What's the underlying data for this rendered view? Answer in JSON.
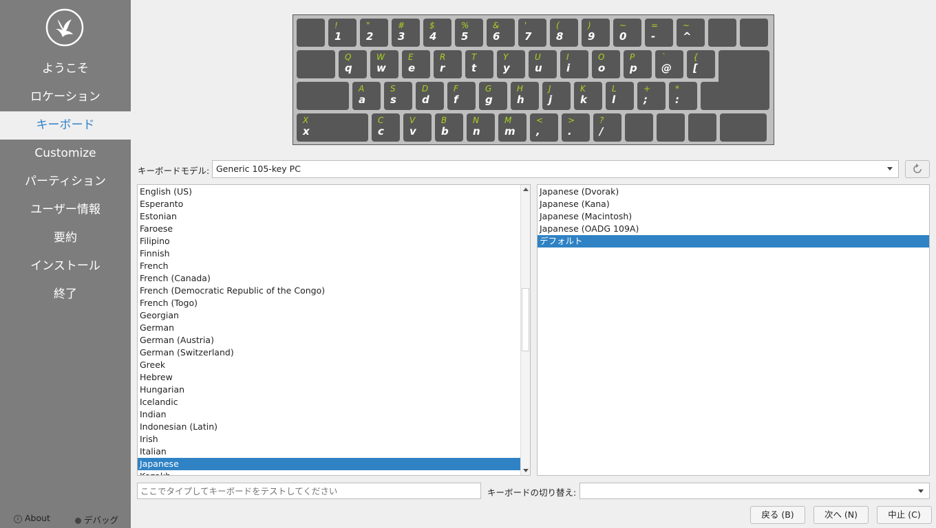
{
  "sidebar": {
    "items": [
      {
        "label": "ようこそ"
      },
      {
        "label": "ロケーション"
      },
      {
        "label": "キーボード",
        "active": true
      },
      {
        "label": "Customize"
      },
      {
        "label": "パーティション"
      },
      {
        "label": "ユーザー情報"
      },
      {
        "label": "要約"
      },
      {
        "label": "インストール"
      },
      {
        "label": "終了"
      }
    ],
    "about_label": "About",
    "debug_label": "デバッグ"
  },
  "keyboard": {
    "keys": [
      {
        "up": "",
        "lo": ""
      },
      {
        "up": "!",
        "lo": "1"
      },
      {
        "up": "\"",
        "lo": "2"
      },
      {
        "up": "#",
        "lo": "3"
      },
      {
        "up": "$",
        "lo": "4"
      },
      {
        "up": "%",
        "lo": "5"
      },
      {
        "up": "&",
        "lo": "6"
      },
      {
        "up": "'",
        "lo": "7"
      },
      {
        "up": "(",
        "lo": "8"
      },
      {
        "up": ")",
        "lo": "9"
      },
      {
        "up": "~",
        "lo": "0"
      },
      {
        "up": "=",
        "lo": "-"
      },
      {
        "up": "~",
        "lo": "^"
      },
      {
        "up": "",
        "lo": ""
      },
      {
        "up": "",
        "lo": ""
      },
      {
        "up": "",
        "lo": ""
      },
      {
        "up": "Q",
        "lo": "q"
      },
      {
        "up": "W",
        "lo": "w"
      },
      {
        "up": "E",
        "lo": "e"
      },
      {
        "up": "R",
        "lo": "r"
      },
      {
        "up": "T",
        "lo": "t"
      },
      {
        "up": "Y",
        "lo": "y"
      },
      {
        "up": "U",
        "lo": "u"
      },
      {
        "up": "I",
        "lo": "i"
      },
      {
        "up": "O",
        "lo": "o"
      },
      {
        "up": "P",
        "lo": "p"
      },
      {
        "up": "`",
        "lo": "@"
      },
      {
        "up": "{",
        "lo": "["
      },
      {
        "up": "",
        "lo": ""
      },
      {
        "up": "",
        "lo": ""
      },
      {
        "up": "A",
        "lo": "a"
      },
      {
        "up": "S",
        "lo": "s"
      },
      {
        "up": "D",
        "lo": "d"
      },
      {
        "up": "F",
        "lo": "f"
      },
      {
        "up": "G",
        "lo": "g"
      },
      {
        "up": "H",
        "lo": "h"
      },
      {
        "up": "J",
        "lo": "j"
      },
      {
        "up": "K",
        "lo": "k"
      },
      {
        "up": "L",
        "lo": "l"
      },
      {
        "up": "+",
        "lo": ";"
      },
      {
        "up": "*",
        "lo": ":"
      },
      {
        "up": "",
        "lo": ""
      },
      {
        "up": "",
        "lo": ""
      },
      {
        "up": "X",
        "lo": "x"
      },
      {
        "up": "C",
        "lo": "c"
      },
      {
        "up": "V",
        "lo": "v"
      },
      {
        "up": "B",
        "lo": "b"
      },
      {
        "up": "N",
        "lo": "n"
      },
      {
        "up": "M",
        "lo": "m"
      },
      {
        "up": "<",
        "lo": ","
      },
      {
        "up": ">",
        "lo": "."
      },
      {
        "up": "?",
        "lo": "/"
      },
      {
        "up": "",
        "lo": ""
      },
      {
        "up": "",
        "lo": ""
      },
      {
        "up": "",
        "lo": ""
      }
    ]
  },
  "model": {
    "label": "キーボードモデル:",
    "value": "Generic 105-key PC"
  },
  "layouts": [
    {
      "label": "English (US)"
    },
    {
      "label": "Esperanto"
    },
    {
      "label": "Estonian"
    },
    {
      "label": "Faroese"
    },
    {
      "label": "Filipino"
    },
    {
      "label": "Finnish"
    },
    {
      "label": "French"
    },
    {
      "label": "French (Canada)"
    },
    {
      "label": "French (Democratic Republic of the Congo)"
    },
    {
      "label": "French (Togo)"
    },
    {
      "label": "Georgian"
    },
    {
      "label": "German"
    },
    {
      "label": "German (Austria)"
    },
    {
      "label": "German (Switzerland)"
    },
    {
      "label": "Greek"
    },
    {
      "label": "Hebrew"
    },
    {
      "label": "Hungarian"
    },
    {
      "label": "Icelandic"
    },
    {
      "label": "Indian"
    },
    {
      "label": "Indonesian (Latin)"
    },
    {
      "label": "Irish"
    },
    {
      "label": "Italian"
    },
    {
      "label": "Japanese",
      "selected": true
    },
    {
      "label": "Kazakh"
    }
  ],
  "variants": [
    {
      "label": "Japanese (Dvorak)"
    },
    {
      "label": "Japanese (Kana)"
    },
    {
      "label": "Japanese (Macintosh)"
    },
    {
      "label": "Japanese (OADG 109A)"
    },
    {
      "label": "デフォルト",
      "selected": true
    }
  ],
  "test_input": {
    "placeholder": "ここでタイプしてキーボードをテストしてください",
    "value": ""
  },
  "switch": {
    "label": "キーボードの切り替え:",
    "value": ""
  },
  "buttons": {
    "back": "戻る (B)",
    "next": "次へ (N)",
    "cancel": "中止 (C)"
  },
  "colors": {
    "accent": "#2f82c4",
    "key_legend": "#a9d31f",
    "sidebar": "#7d7d7d"
  }
}
